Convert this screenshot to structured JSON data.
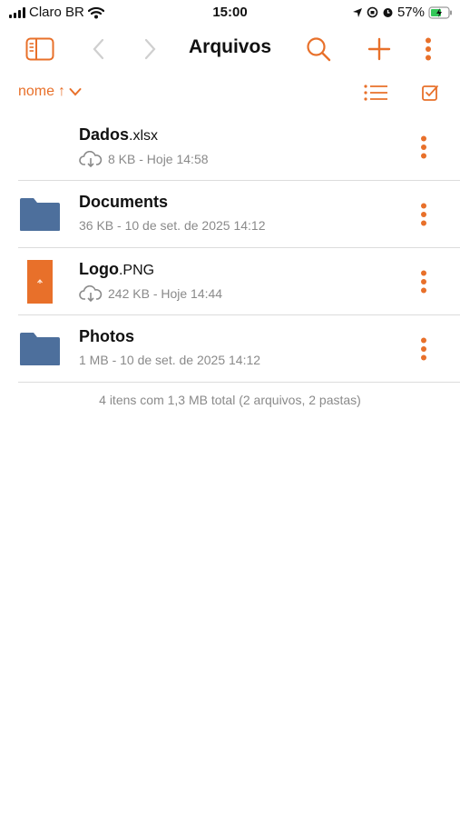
{
  "status_bar": {
    "carrier": "Claro BR",
    "time": "15:00",
    "battery": "57%"
  },
  "nav": {
    "title": "Arquivos",
    "icons": [
      "sidebar-icon",
      "back-chevron-icon",
      "forward-chevron-icon",
      "search-icon",
      "plus-icon",
      "more-vertical-icon"
    ]
  },
  "sort": {
    "label": "nome",
    "direction": "↑"
  },
  "files": [
    {
      "base": "Dados",
      "ext": ".xlsx",
      "meta": "8 KB - Hoje 14:58",
      "cloud": true,
      "kind": "blank"
    },
    {
      "base": "Documents",
      "ext": "",
      "meta": "36 KB - 10 de set. de 2025 14:12",
      "cloud": false,
      "kind": "folder"
    },
    {
      "base": "Logo",
      "ext": ".PNG",
      "meta": "242 KB - Hoje 14:44",
      "cloud": true,
      "kind": "image"
    },
    {
      "base": "Photos",
      "ext": "",
      "meta": "1 MB - 10 de set. de 2025 14:12",
      "cloud": false,
      "kind": "folder"
    }
  ],
  "summary": "4 itens com 1,3 MB total (2 arquivos, 2 pastas)",
  "colors": {
    "accent": "#e8702a",
    "folder": "#4d6f9c",
    "image_thumb": "#e8702a",
    "secondary_text": "#8a8a8a"
  }
}
